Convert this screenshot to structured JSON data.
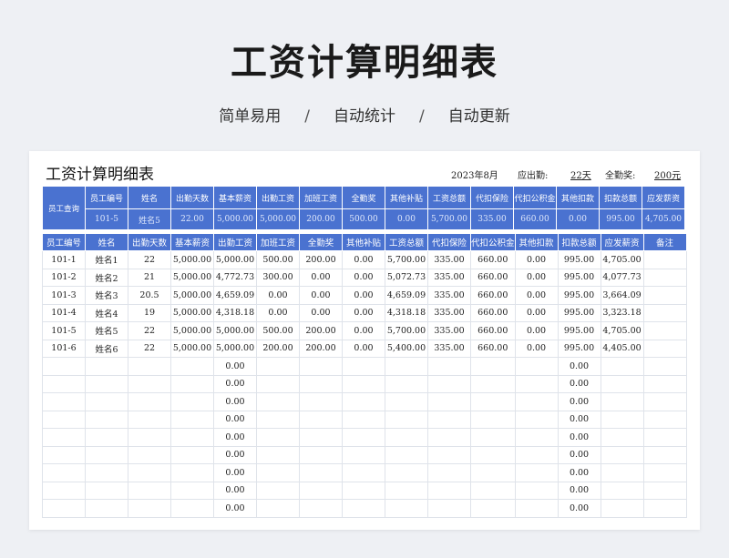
{
  "hero": {
    "title": "工资计算明细表",
    "tags": [
      "简单易用",
      "自动统计",
      "自动更新"
    ],
    "separator": "/"
  },
  "sheet": {
    "title": "工资计算明细表",
    "month": "2023年8月",
    "due_label": "应出勤:",
    "due_value": "22天",
    "bonus_label": "全勤奖:",
    "bonus_value": "200元"
  },
  "lookup": {
    "row_label": "员工查询",
    "headers": [
      "员工编号",
      "姓名",
      "出勤天数",
      "基本薪资",
      "出勤工资",
      "加班工资",
      "全勤奖",
      "其他补贴",
      "工资总额",
      "代扣保险",
      "代扣公积金",
      "其他扣款",
      "扣款总额",
      "应发薪资"
    ],
    "values": [
      "101-5",
      "姓名5",
      "22.00",
      "5,000.00",
      "5,000.00",
      "200.00",
      "500.00",
      "0.00",
      "5,700.00",
      "335.00",
      "660.00",
      "0.00",
      "995.00",
      "4,705.00"
    ]
  },
  "table": {
    "headers": [
      "员工编号",
      "姓名",
      "出勤天数",
      "基本薪资",
      "出勤工资",
      "加班工资",
      "全勤奖",
      "其他补贴",
      "工资总额",
      "代扣保险",
      "代扣公积金",
      "其他扣款",
      "扣款总额",
      "应发薪资",
      "备注"
    ],
    "rows": [
      [
        "101-1",
        "姓名1",
        "22",
        "5,000.00",
        "5,000.00",
        "500.00",
        "200.00",
        "0.00",
        "5,700.00",
        "335.00",
        "660.00",
        "0.00",
        "995.00",
        "4,705.00",
        ""
      ],
      [
        "101-2",
        "姓名2",
        "21",
        "5,000.00",
        "4,772.73",
        "300.00",
        "0.00",
        "0.00",
        "5,072.73",
        "335.00",
        "660.00",
        "0.00",
        "995.00",
        "4,077.73",
        ""
      ],
      [
        "101-3",
        "姓名3",
        "20.5",
        "5,000.00",
        "4,659.09",
        "0.00",
        "0.00",
        "0.00",
        "4,659.09",
        "335.00",
        "660.00",
        "0.00",
        "995.00",
        "3,664.09",
        ""
      ],
      [
        "101-4",
        "姓名4",
        "19",
        "5,000.00",
        "4,318.18",
        "0.00",
        "0.00",
        "0.00",
        "4,318.18",
        "335.00",
        "660.00",
        "0.00",
        "995.00",
        "3,323.18",
        ""
      ],
      [
        "101-5",
        "姓名5",
        "22",
        "5,000.00",
        "5,000.00",
        "500.00",
        "200.00",
        "0.00",
        "5,700.00",
        "335.00",
        "660.00",
        "0.00",
        "995.00",
        "4,705.00",
        ""
      ],
      [
        "101-6",
        "姓名6",
        "22",
        "5,000.00",
        "5,000.00",
        "200.00",
        "200.00",
        "0.00",
        "5,400.00",
        "335.00",
        "660.00",
        "0.00",
        "995.00",
        "4,405.00",
        ""
      ],
      [
        "",
        "",
        "",
        "",
        "0.00",
        "",
        "",
        "",
        "",
        "",
        "",
        "",
        "0.00",
        "",
        ""
      ],
      [
        "",
        "",
        "",
        "",
        "0.00",
        "",
        "",
        "",
        "",
        "",
        "",
        "",
        "0.00",
        "",
        ""
      ],
      [
        "",
        "",
        "",
        "",
        "0.00",
        "",
        "",
        "",
        "",
        "",
        "",
        "",
        "0.00",
        "",
        ""
      ],
      [
        "",
        "",
        "",
        "",
        "0.00",
        "",
        "",
        "",
        "",
        "",
        "",
        "",
        "0.00",
        "",
        ""
      ],
      [
        "",
        "",
        "",
        "",
        "0.00",
        "",
        "",
        "",
        "",
        "",
        "",
        "",
        "0.00",
        "",
        ""
      ],
      [
        "",
        "",
        "",
        "",
        "0.00",
        "",
        "",
        "",
        "",
        "",
        "",
        "",
        "0.00",
        "",
        ""
      ],
      [
        "",
        "",
        "",
        "",
        "0.00",
        "",
        "",
        "",
        "",
        "",
        "",
        "",
        "0.00",
        "",
        ""
      ],
      [
        "",
        "",
        "",
        "",
        "0.00",
        "",
        "",
        "",
        "",
        "",
        "",
        "",
        "0.00",
        "",
        ""
      ],
      [
        "",
        "",
        "",
        "",
        "0.00",
        "",
        "",
        "",
        "",
        "",
        "",
        "",
        "0.00",
        "",
        ""
      ]
    ]
  }
}
